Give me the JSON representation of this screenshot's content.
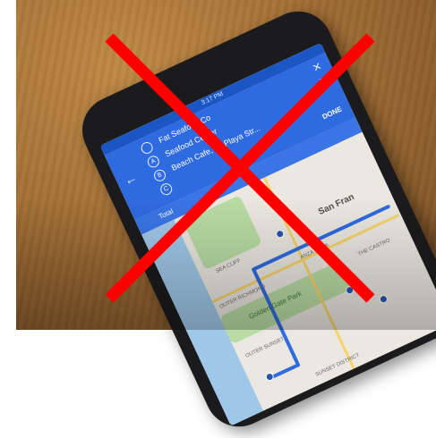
{
  "photo": {
    "subject": "smartphone on wooden table showing a map route",
    "phone": {
      "status_time": "3:17 PM",
      "stops": [
        {
          "badge": "",
          "label": "Fat Seafood Co"
        },
        {
          "badge": "A",
          "label": "Seafood Center"
        },
        {
          "badge": "B",
          "label": "Beach Cafe, La Playa Str..."
        },
        {
          "badge": "C",
          "label": ""
        }
      ],
      "done_label": "DONE",
      "summary": "Total",
      "map_labels": {
        "city": "San Fran",
        "park": "Golden Gate Park",
        "outer_richmond": "OUTER RICHMOND",
        "sea_cliff": "SEA CLIFF",
        "outer_sunset": "OUTER SUNSET",
        "anza_vista": "ANZA VISTA",
        "the_castro": "THE CASTRO",
        "sunset_district": "SUNSET DISTRICT"
      }
    }
  },
  "overlay": {
    "mark": "red-x",
    "color": "#ff0000"
  }
}
